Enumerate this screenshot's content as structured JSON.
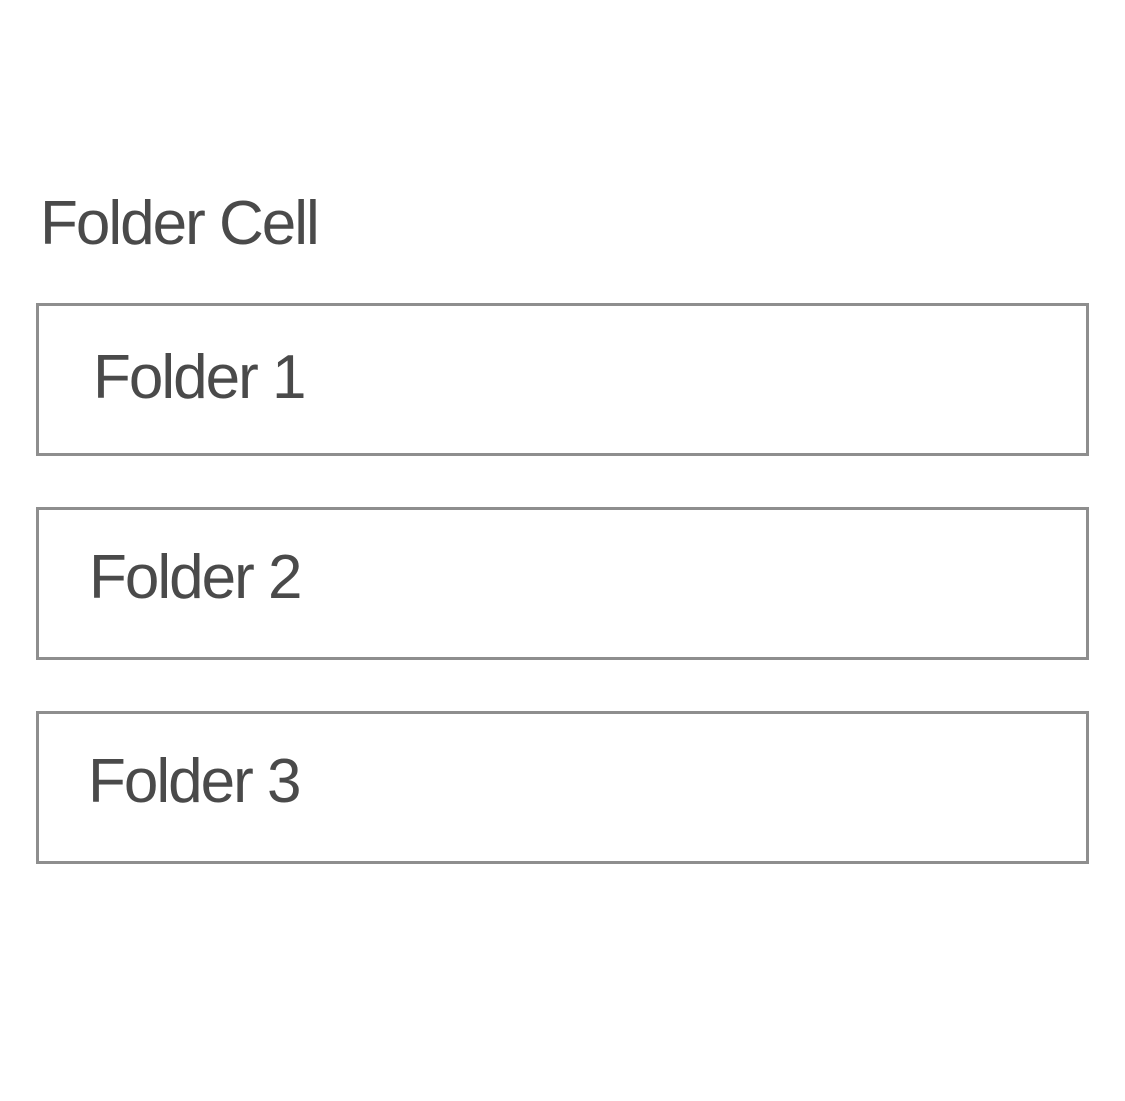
{
  "header": {
    "title": "Folder Cell"
  },
  "folders": [
    {
      "label": "Folder 1"
    },
    {
      "label": "Folder 2"
    },
    {
      "label": "Folder 3"
    }
  ],
  "colors": {
    "text": "#4a4a4a",
    "border": "#8e8e8e",
    "background": "#ffffff"
  }
}
